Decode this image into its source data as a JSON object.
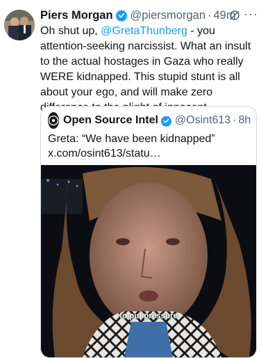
{
  "tweet": {
    "author_name": "Piers Morgan",
    "handle": "@piersmorgan",
    "separator": "·",
    "time": "49m",
    "text_before": "Oh shut up, ",
    "mention": "@GretaThunberg",
    "text_after": " - you attention-seeking narcissist. What an insult to the actual hostages in Gaza who really WERE kidnapped. This stupid stunt is all about your ego, and will make zero difference to the plight of innocent Palestinians caught up in this dreadful war."
  },
  "quoted": {
    "author_name": "Open Source Intel",
    "handle": "@Osint613",
    "separator": "·",
    "time": "8h",
    "text": "Greta: “We have been kidnapped” x.com/osint613/statu…",
    "video_caption": "to put pressure"
  },
  "icons": {
    "verified": "verified-badge-icon",
    "grok": "grok-icon",
    "more": "more-options-icon"
  },
  "colors": {
    "link": "#1d9bf0",
    "verified": "#1d9bf0",
    "secondary_text": "#536471",
    "border": "#cfd9de"
  }
}
